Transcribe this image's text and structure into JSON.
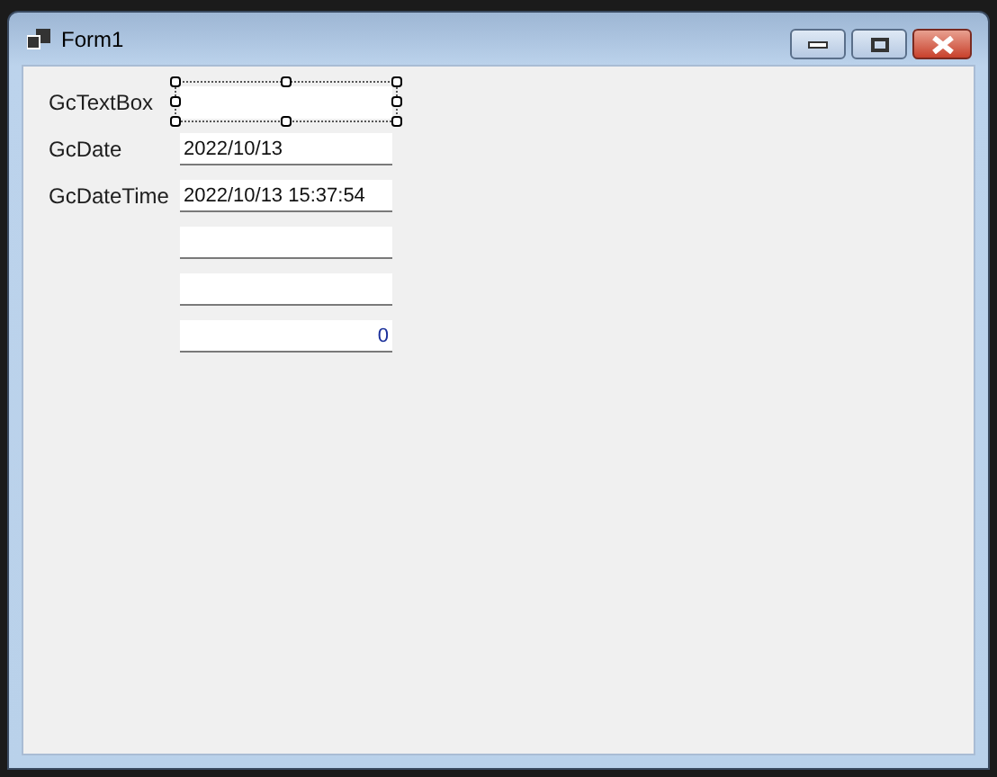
{
  "window": {
    "title": "Form1"
  },
  "fields": [
    {
      "label": "GcTextBox",
      "kind": "text",
      "selected": true
    },
    {
      "label": "GcDate",
      "kind": "text",
      "value": "2022/10/13",
      "selected": false
    },
    {
      "label": "GcDateTime",
      "kind": "text",
      "value": "2022/10/13 15:37:54",
      "selected": false
    },
    {
      "kind": "text",
      "selected": false
    },
    {
      "kind": "text",
      "selected": false
    },
    {
      "kind": "numeric",
      "value": "0",
      "selected": false
    }
  ]
}
